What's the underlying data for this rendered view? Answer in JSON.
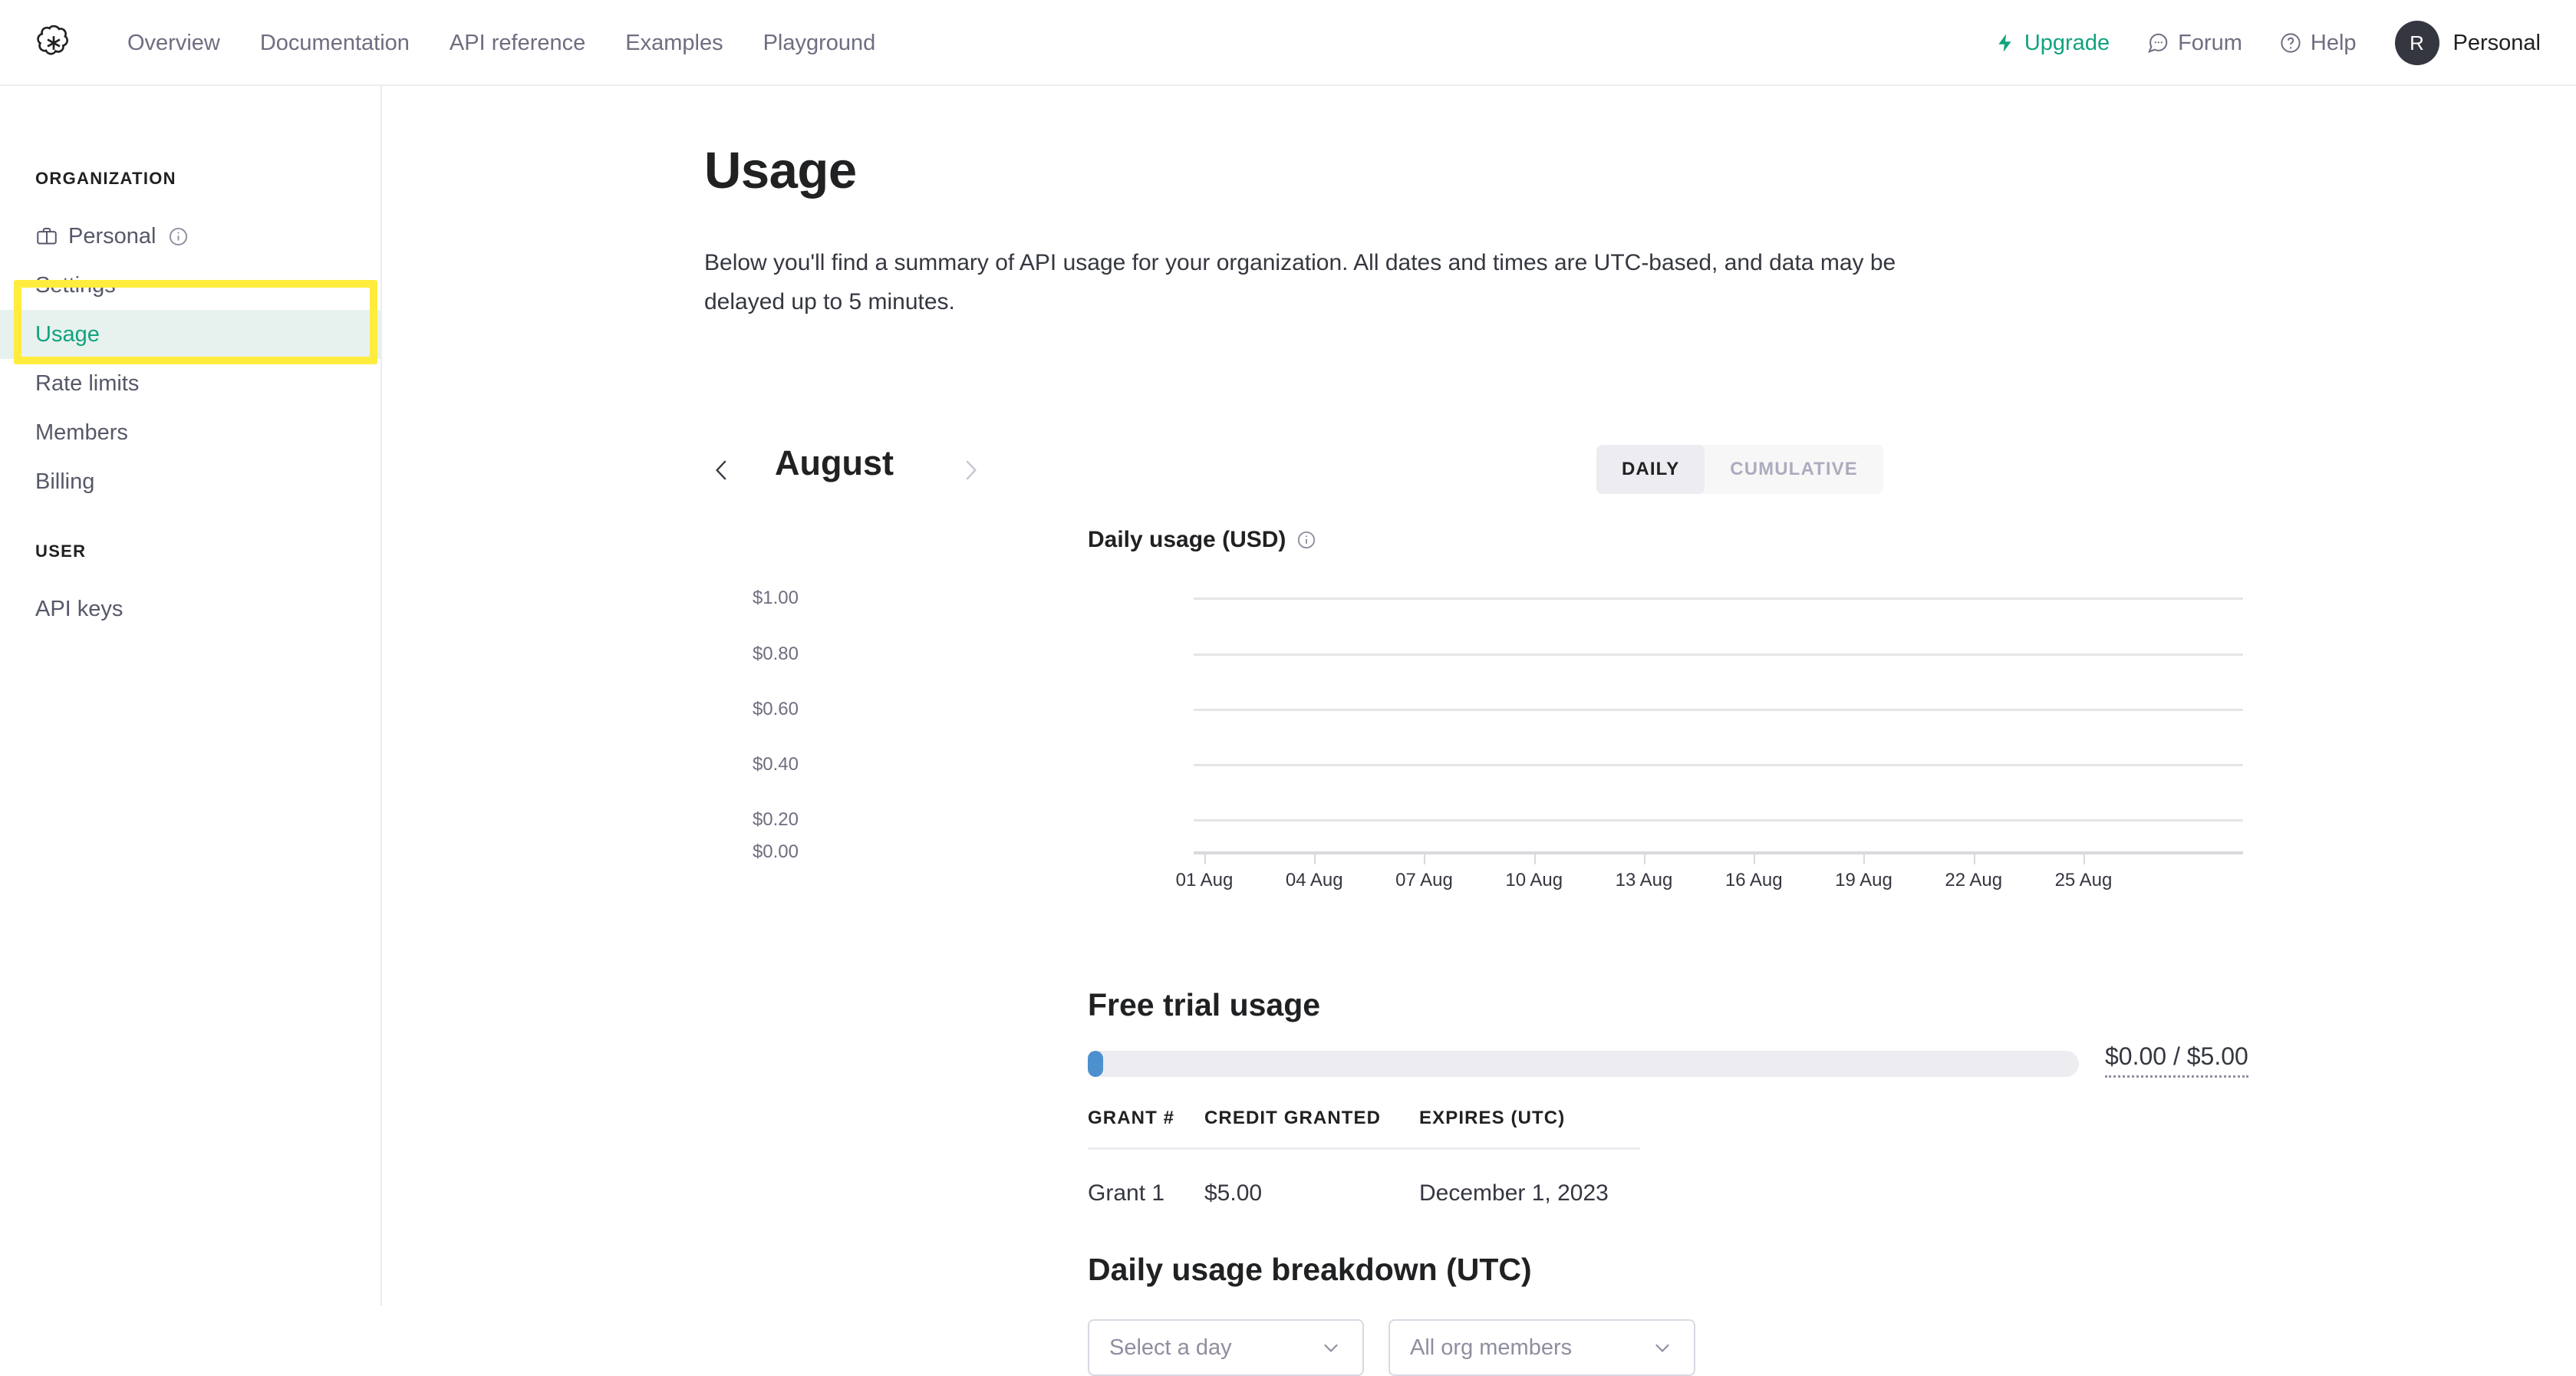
{
  "header": {
    "logo_icon": "openai-logo",
    "nav": [
      {
        "label": "Overview"
      },
      {
        "label": "Documentation"
      },
      {
        "label": "API reference"
      },
      {
        "label": "Examples"
      },
      {
        "label": "Playground"
      }
    ],
    "upgrade_label": "Upgrade",
    "forum_label": "Forum",
    "help_label": "Help",
    "avatar_initial": "R",
    "account_label": "Personal"
  },
  "sidebar": {
    "org_title": "ORGANIZATION",
    "user_title": "USER",
    "org_items": [
      {
        "label": "Personal",
        "icon": "briefcase-icon",
        "info": "info-icon"
      },
      {
        "label": "Settings"
      },
      {
        "label": "Usage",
        "active": true
      },
      {
        "label": "Rate limits"
      },
      {
        "label": "Members"
      },
      {
        "label": "Billing"
      }
    ],
    "user_items": [
      {
        "label": "API keys"
      }
    ],
    "active_color": "#10a37f",
    "active_bg": "#e7f1ee",
    "highlight_color": "#ffec3d"
  },
  "main": {
    "title": "Usage",
    "description": "Below you'll find a summary of API usage for your organization. All dates and times are UTC-based, and data may be delayed up to 5 minutes.",
    "month": "August",
    "prev_label": "‹",
    "next_label": "›",
    "toggle": {
      "daily": "DAILY",
      "cumulative": "CUMULATIVE",
      "selected": "DAILY"
    },
    "free_trial": {
      "title": "Free trial usage",
      "amount": "$0.00 / $5.00",
      "used": 0.0,
      "total": 5.0,
      "columns": [
        "GRANT #",
        "CREDIT GRANTED",
        "EXPIRES (UTC)"
      ],
      "rows": [
        {
          "grant": "Grant 1",
          "credit": "$5.00",
          "expires": "December 1, 2023"
        }
      ]
    },
    "breakdown": {
      "title": "Daily usage breakdown (UTC)",
      "day_select_placeholder": "Select a day",
      "member_select_placeholder": "All org members",
      "chevron_icon": "chevron-down-icon"
    }
  },
  "chart_data": {
    "type": "bar",
    "title": "Daily usage (USD)",
    "info_icon": "info-icon",
    "xlabel": "",
    "ylabel": "",
    "categories": [
      "01 Aug",
      "04 Aug",
      "07 Aug",
      "10 Aug",
      "13 Aug",
      "16 Aug",
      "19 Aug",
      "22 Aug",
      "25 Aug"
    ],
    "values": [
      0,
      0,
      0,
      0,
      0,
      0,
      0,
      0,
      0
    ],
    "ytick_labels": [
      "$1.00",
      "$0.80",
      "$0.60",
      "$0.40",
      "$0.20",
      "$0.00"
    ],
    "ylim": [
      0,
      1.0
    ],
    "grid": true,
    "legend": "none"
  }
}
